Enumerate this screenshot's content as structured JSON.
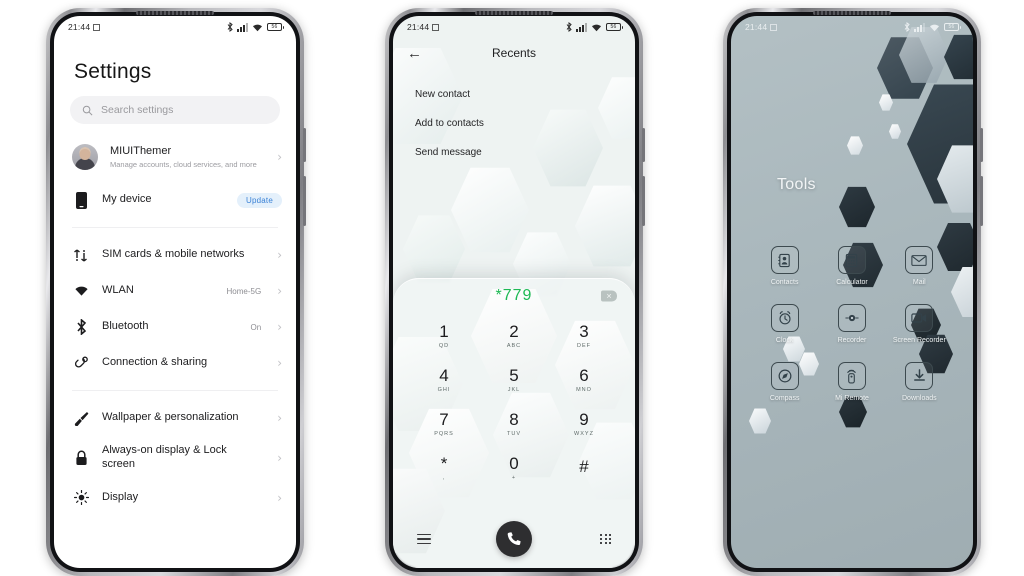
{
  "meta": {
    "background_color": "#ffffff",
    "bezel_dark": "#111215"
  },
  "status_bar": {
    "time": "21:44",
    "icons": [
      "alarm-icon",
      "bluetooth-icon",
      "signal-icon",
      "wifi-icon",
      "battery-icon"
    ],
    "battery_level": "56"
  },
  "phone1": {
    "app": "Settings",
    "title": "Settings",
    "search": {
      "placeholder": "Search settings",
      "icon": "search-icon"
    },
    "account": {
      "name": "MIUIThemer",
      "subtitle": "Manage accounts, cloud services, and more"
    },
    "device": {
      "label": "My device",
      "badge": "Update",
      "badge_color": "#3b82d6",
      "badge_bg": "#e4f0fb"
    },
    "items": [
      {
        "label": "SIM cards & mobile networks",
        "value": "",
        "icon": "sim-icon"
      },
      {
        "label": "WLAN",
        "value": "Home-5G",
        "icon": "wifi-icon"
      },
      {
        "label": "Bluetooth",
        "value": "On",
        "icon": "bluetooth-icon"
      },
      {
        "label": "Connection & sharing",
        "value": "",
        "icon": "link-icon"
      }
    ],
    "items2": [
      {
        "label": "Wallpaper & personalization",
        "value": "",
        "icon": "brush-icon"
      },
      {
        "label": "Always-on display & Lock screen",
        "value": "",
        "icon": "lock-icon"
      },
      {
        "label": "Display",
        "value": "",
        "icon": "brightness-icon"
      }
    ],
    "chevron": "›"
  },
  "phone2": {
    "app": "Dialer",
    "header": {
      "title": "Recents",
      "back_icon": "back-arrow-icon"
    },
    "menu_items": [
      "New contact",
      "Add to contacts",
      "Send message"
    ],
    "dialed_number": "*779",
    "number_color": "#1db954",
    "backspace_icon": "backspace-icon",
    "keys": [
      {
        "num": "1",
        "letters": "QD"
      },
      {
        "num": "2",
        "letters": "ABC"
      },
      {
        "num": "3",
        "letters": "DEF"
      },
      {
        "num": "4",
        "letters": "GHI"
      },
      {
        "num": "5",
        "letters": "JKL"
      },
      {
        "num": "6",
        "letters": "MNO"
      },
      {
        "num": "7",
        "letters": "PQRS"
      },
      {
        "num": "8",
        "letters": "TUV"
      },
      {
        "num": "9",
        "letters": "WXYZ"
      },
      {
        "num": "*",
        "letters": ","
      },
      {
        "num": "0",
        "letters": "+"
      },
      {
        "num": "#",
        "letters": ""
      }
    ],
    "bottom_bar": {
      "menu_icon": "hamburger-menu-icon",
      "call_icon": "phone-call-icon",
      "keypad_icon": "keypad-grid-icon"
    }
  },
  "phone3": {
    "app": "Home screen",
    "folder_title": "Tools",
    "apps": [
      {
        "name": "Contacts",
        "icon": "contacts-icon"
      },
      {
        "name": "Calculator",
        "icon": "calculator-icon"
      },
      {
        "name": "Mail",
        "icon": "mail-icon"
      },
      {
        "name": "Clock",
        "icon": "alarm-clock-icon"
      },
      {
        "name": "Recorder",
        "icon": "recorder-icon"
      },
      {
        "name": "Screen Recorder",
        "icon": "screen-recorder-icon"
      },
      {
        "name": "Compass",
        "icon": "compass-icon"
      },
      {
        "name": "Mi Remote",
        "icon": "remote-icon"
      },
      {
        "name": "Downloads",
        "icon": "download-icon"
      }
    ]
  }
}
